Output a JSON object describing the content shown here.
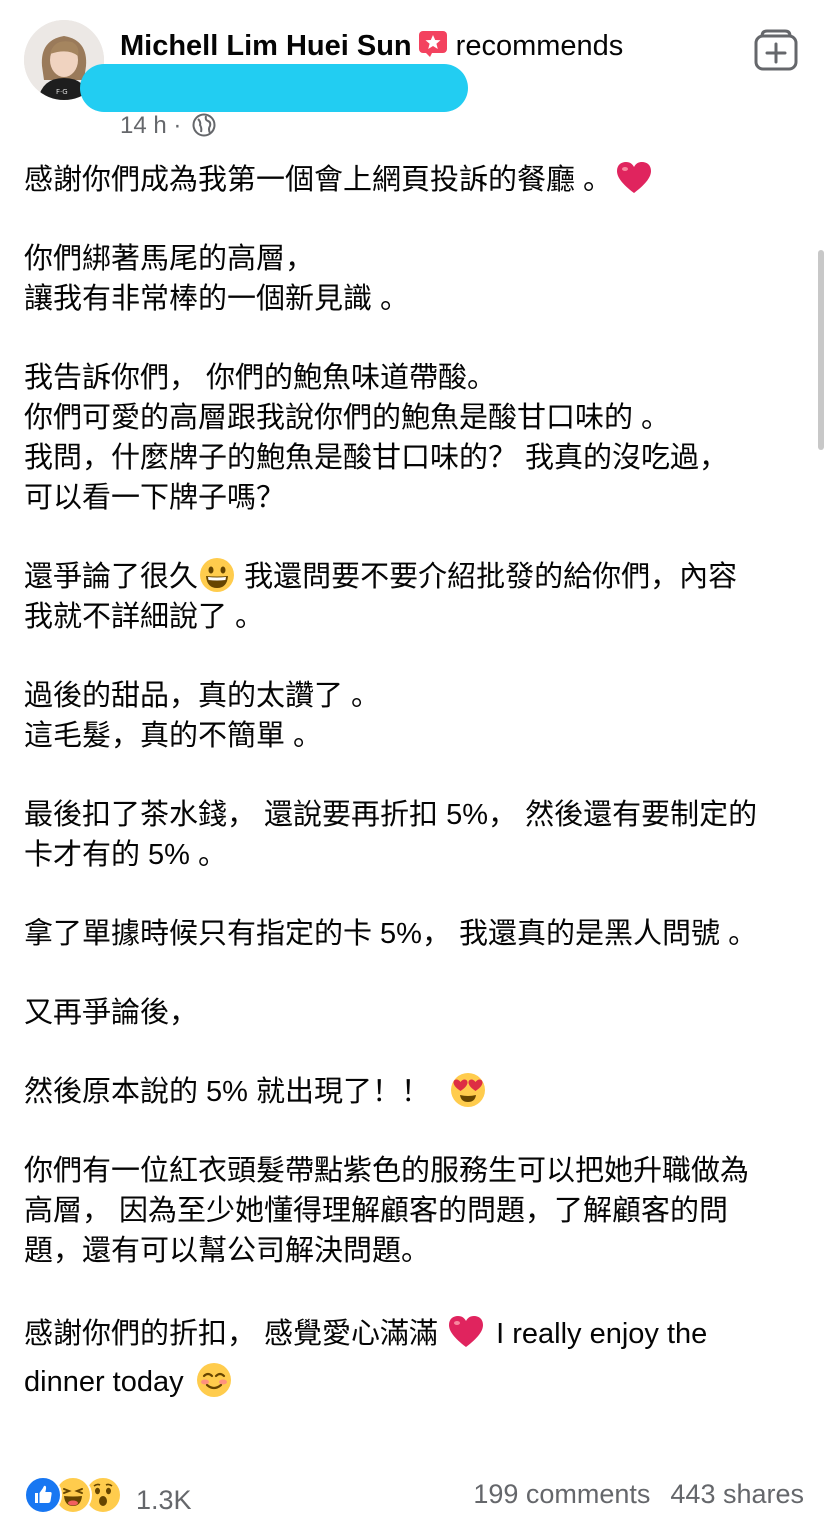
{
  "post": {
    "author": "Michell Lim Huei Sun",
    "action": "recommends",
    "time": "14 h ·",
    "paragraphs": [
      "感謝你們成為我第一個會上網頁投訴的餐廳 。",
      "你們綁著馬尾的高層，\n讓我有非常棒的一個新見識 。",
      "我告訴你們， 你們的鮑魚味道帶酸。\n你們可愛的高層跟我說你們的鮑魚是酸甘口味的 。\n我問，什麼牌子的鮑魚是酸甘口味的？ 我真的沒吃過，\n可以看一下牌子嗎？",
      "還爭論了很久",
      " 我還問要不要介紹批發的給你們，內容\n我就不詳細說了 。",
      "過後的甜品，真的太讚了 。\n這毛髮，真的不簡單 。",
      "最後扣了茶水錢， 還說要再折扣 5%， 然後還有要制定的\n卡才有的 5% 。",
      "拿了單據時候只有指定的卡 5%， 我還真的是黑人問號 。",
      "又再爭論後，",
      "然後原本說的 5% 就出現了！！",
      "你們有一位紅衣頭髮帶點紫色的服務生可以把她升職做為\n高層， 因為至少她懂得理解顧客的問題，了解顧客的問\n題，還有可以幫公司解決問題。",
      "感謝你們的折扣， 感覺愛心滿滿",
      " I really enjoy the\ndinner today"
    ]
  },
  "footer": {
    "reaction_count": "1.3K",
    "comments": "199 comments",
    "shares": "443 shares"
  },
  "icons": {
    "badge_color": "#f3425f",
    "heart_color": "#e0245e",
    "like_color": "#1877f2"
  }
}
